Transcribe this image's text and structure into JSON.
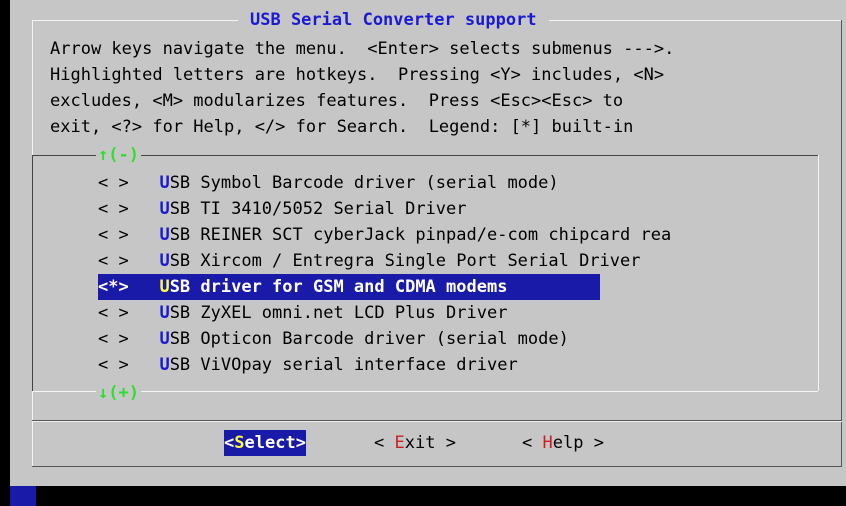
{
  "dialog": {
    "title": "USB Serial Converter support",
    "help_lines": [
      "Arrow keys navigate the menu.  <Enter> selects submenus --->.",
      "Highlighted letters are hotkeys.  Pressing <Y> includes, <N>",
      "excludes, <M> modularizes features.  Press <Esc><Esc> to",
      "exit, <?> for Help, </> for Search.  Legend: [*] built-in"
    ],
    "scroll_up": "↑(-)",
    "scroll_down": "↓(+)"
  },
  "menu": {
    "items": [
      {
        "mark": "< >",
        "hotkey": "U",
        "rest": "SB Symbol Barcode driver (serial mode)"
      },
      {
        "mark": "< >",
        "hotkey": "U",
        "rest": "SB TI 3410/5052 Serial Driver"
      },
      {
        "mark": "< >",
        "hotkey": "U",
        "rest": "SB REINER SCT cyberJack pinpad/e-com chipcard rea"
      },
      {
        "mark": "< >",
        "hotkey": "U",
        "rest": "SB Xircom / Entregra Single Port Serial Driver"
      },
      {
        "mark": "<*>",
        "hotkey": "U",
        "rest": "SB driver for GSM and CDMA modems"
      },
      {
        "mark": "< >",
        "hotkey": "U",
        "rest": "SB ZyXEL omni.net LCD Plus Driver"
      },
      {
        "mark": "< >",
        "hotkey": "U",
        "rest": "SB Opticon Barcode driver (serial mode)"
      },
      {
        "mark": "< >",
        "hotkey": "U",
        "rest": "SB ViVOpay serial interface driver"
      }
    ],
    "selected_index": 4
  },
  "buttons": {
    "select": {
      "open": "<",
      "hotkey": "S",
      "rest": "elect",
      "close": ">"
    },
    "exit": {
      "open": "< ",
      "hotkey": "E",
      "rest": "xit",
      "close": " >"
    },
    "help": {
      "open": "< ",
      "hotkey": "H",
      "rest": "elp",
      "close": " >"
    }
  },
  "colors": {
    "background": "#c6c6c6",
    "title": "#1a1ad0",
    "selection": "#1a1aa8",
    "selection_hotkey": "#ffff40",
    "scroll_arrows": "#2ee02e",
    "button_hotkey": "#cc2020"
  }
}
